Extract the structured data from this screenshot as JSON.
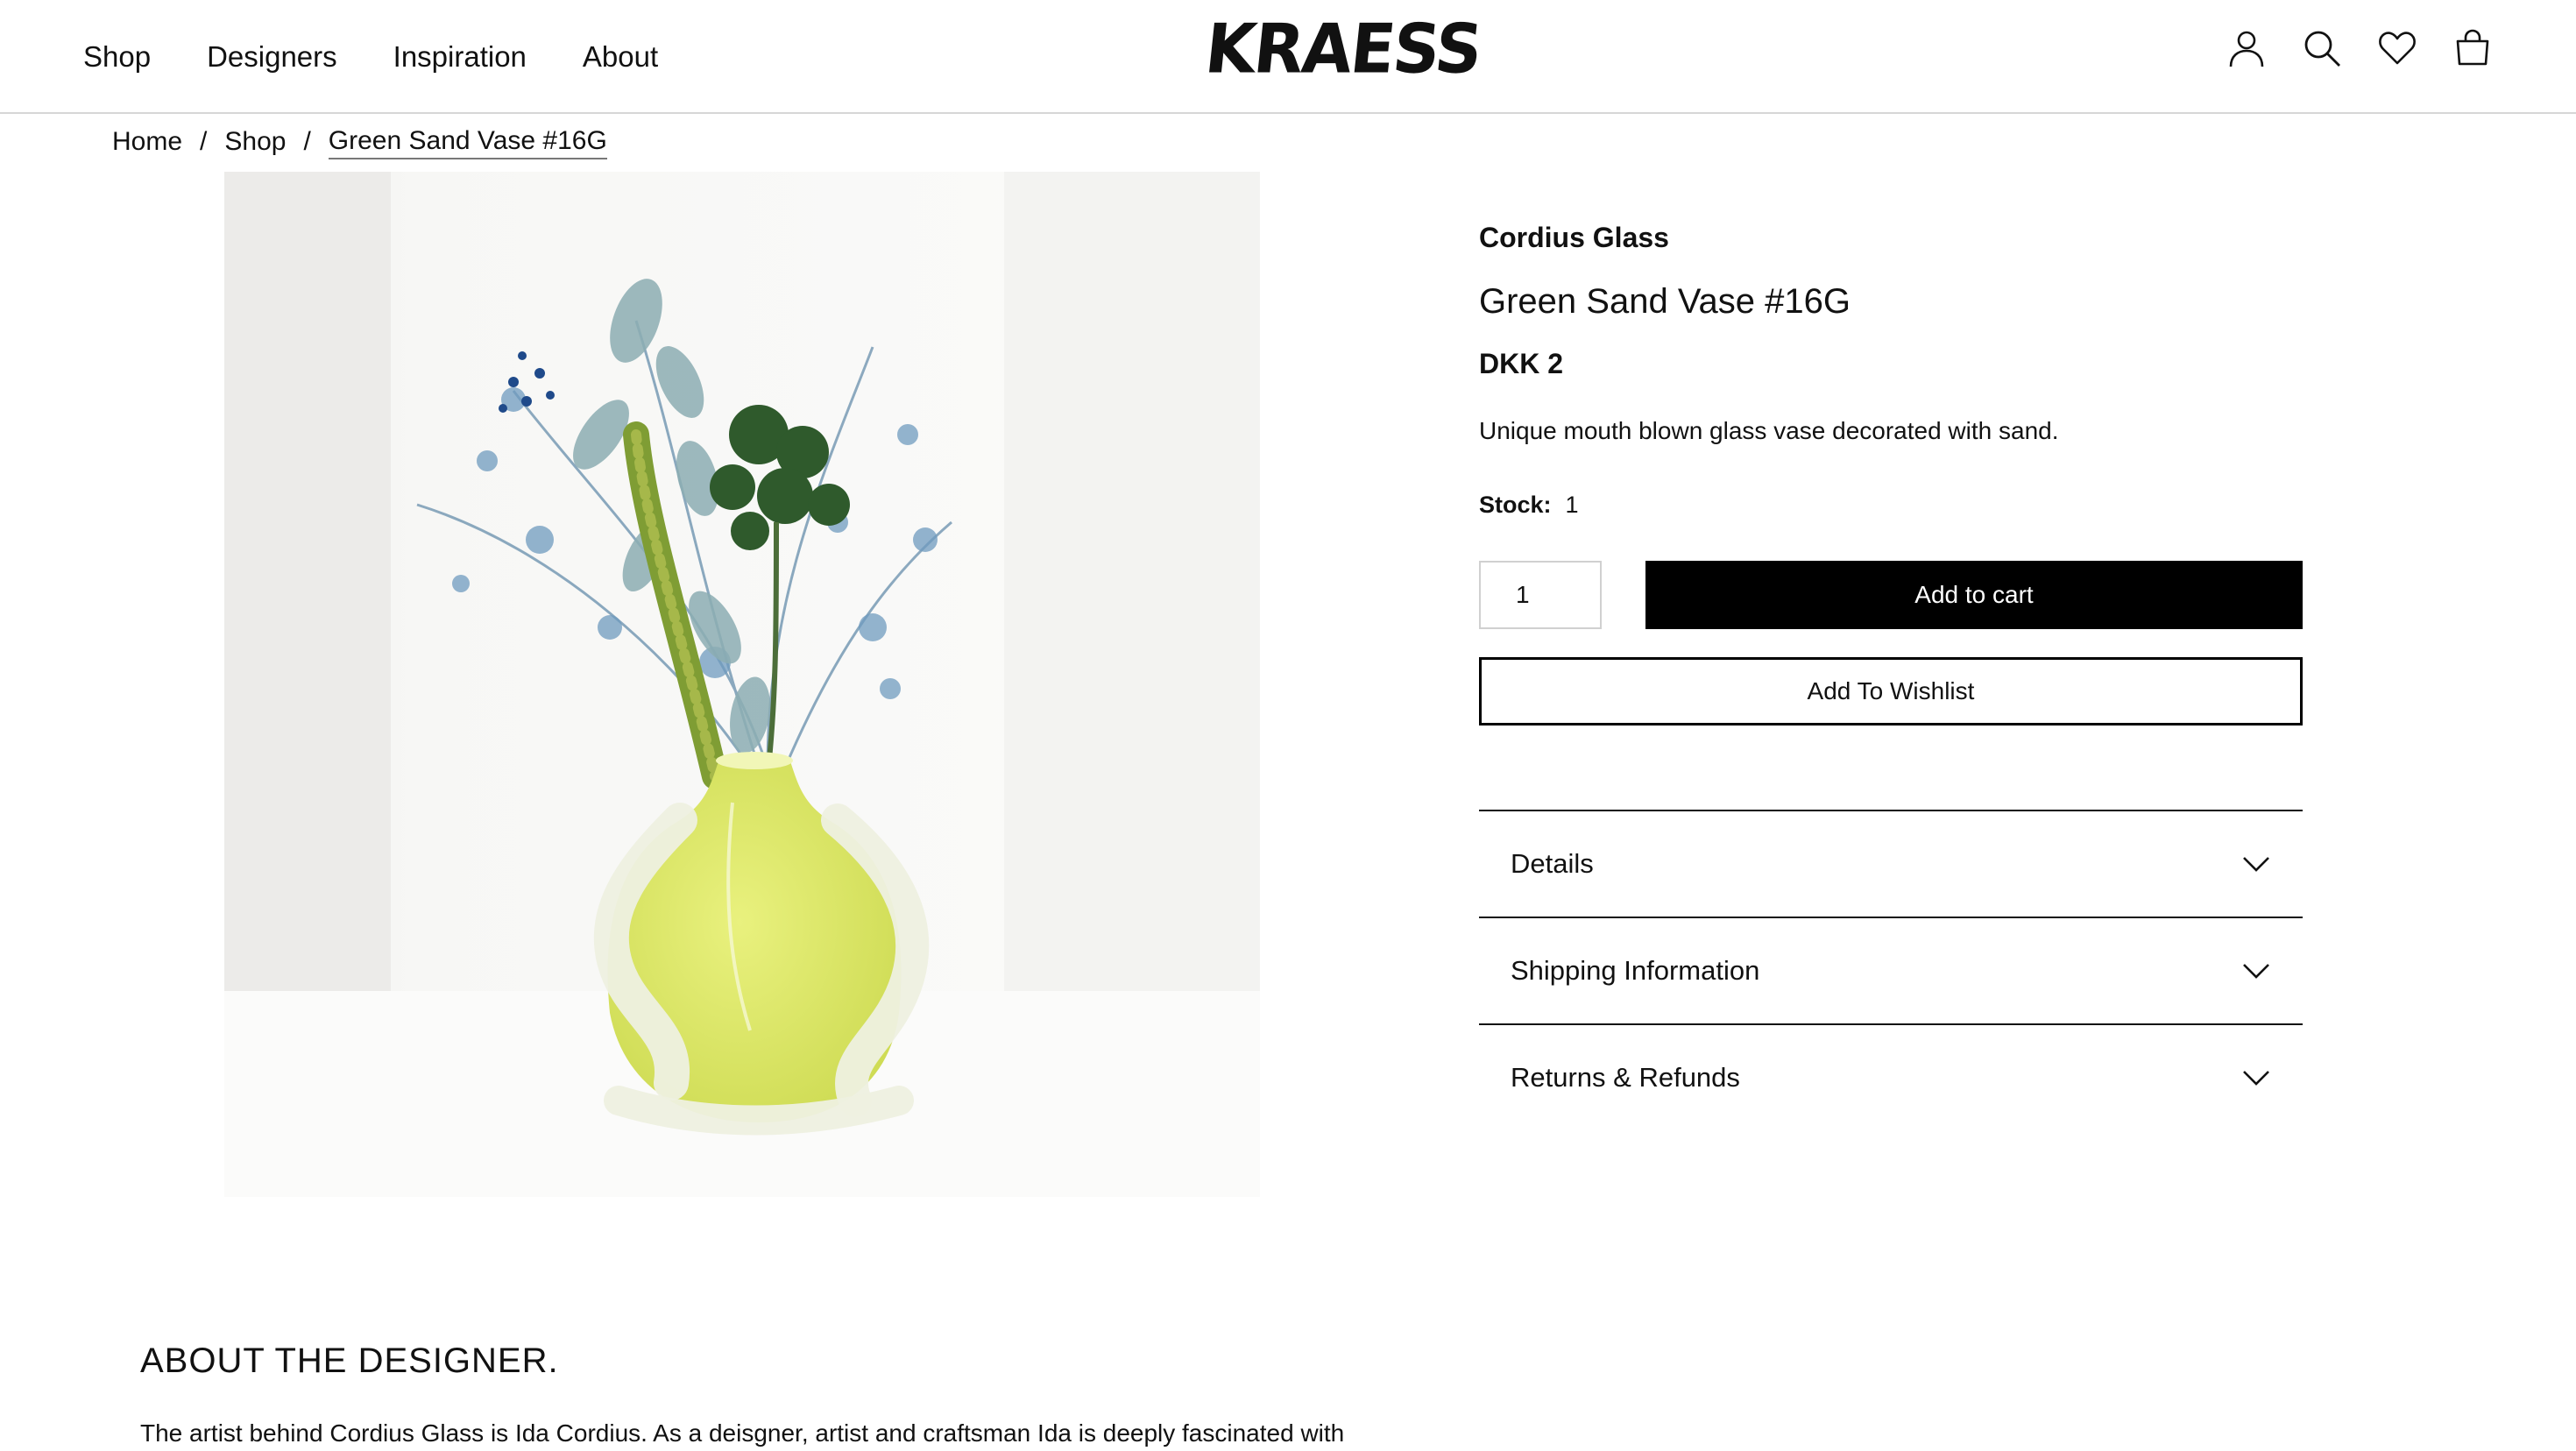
{
  "nav": {
    "items": [
      "Shop",
      "Designers",
      "Inspiration",
      "About"
    ]
  },
  "logo": {
    "text": "KRAESS"
  },
  "header_icons": [
    "account-icon",
    "search-icon",
    "wishlist-heart-icon",
    "cart-bag-icon"
  ],
  "breadcrumb": {
    "items": [
      "Home",
      "Shop"
    ],
    "separator": "/",
    "current": "Green Sand Vase #16G"
  },
  "product": {
    "brand": "Cordius Glass",
    "title": "Green Sand Vase #16G",
    "price": "DKK 2",
    "description": "Unique mouth blown glass vase decorated with sand.",
    "stock_label": "Stock:",
    "stock_value": "1",
    "quantity": "1",
    "add_to_cart": "Add to cart",
    "add_to_wishlist": "Add To Wishlist",
    "accordion": [
      "Details",
      "Shipping Information",
      "Returns & Refunds"
    ]
  },
  "about": {
    "heading": "ABOUT THE DESIGNER.",
    "text": "The artist behind Cordius Glass is Ida Cordius. As a deisgner, artist and craftsman Ida is deeply fascinated with"
  },
  "colors": {
    "primary_button": "#000000",
    "vase": "#d9e66a",
    "text": "#111111"
  }
}
